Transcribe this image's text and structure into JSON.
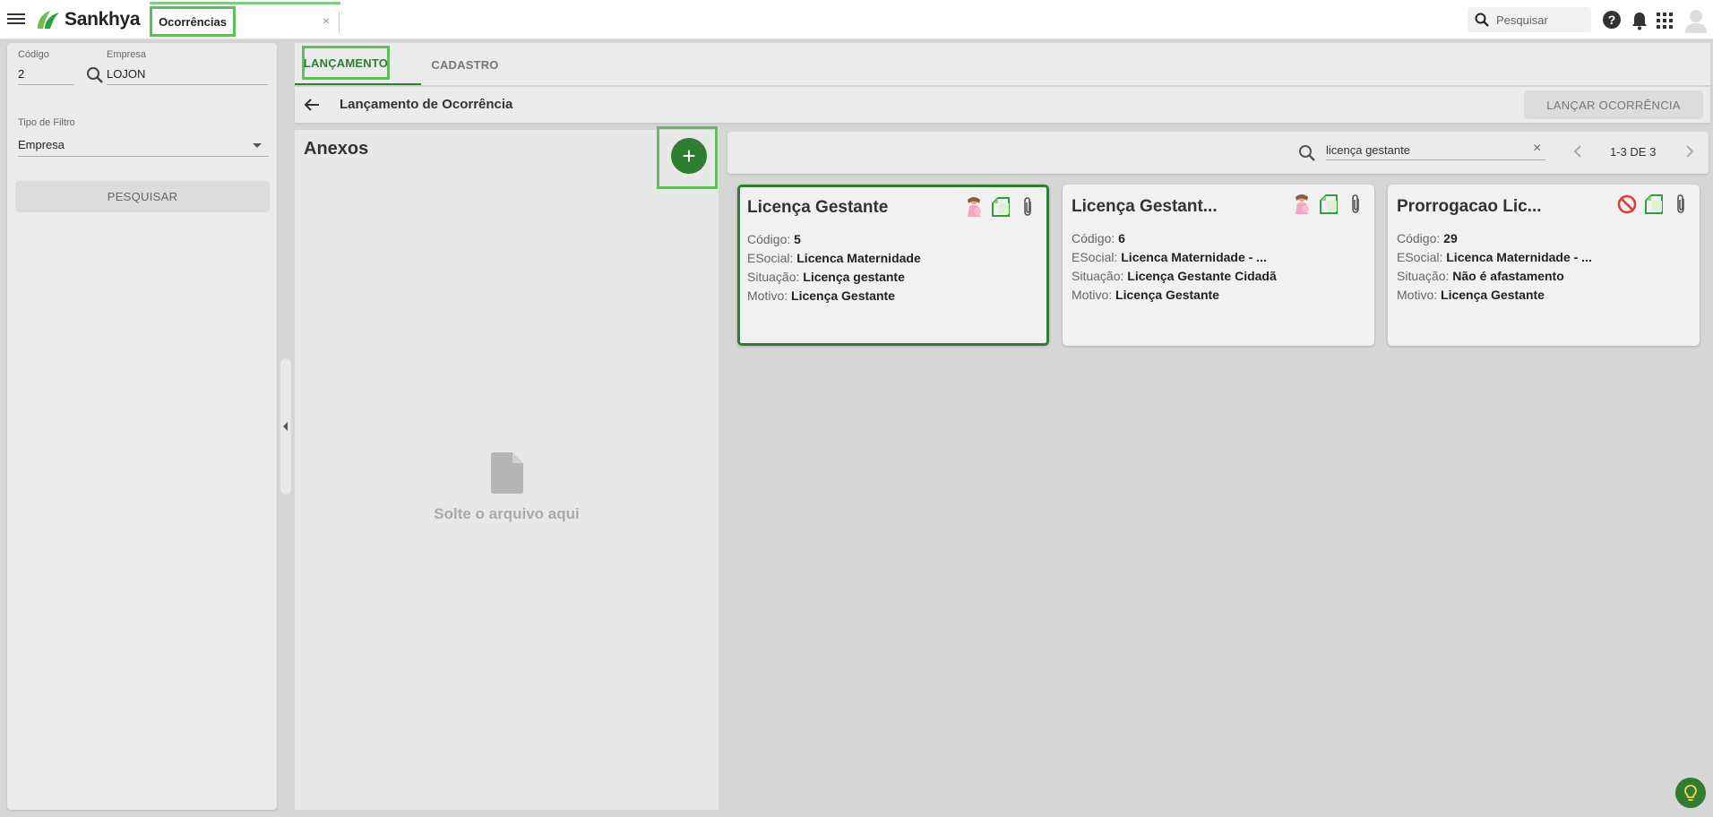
{
  "topbar": {
    "brand": "Sankhya",
    "app_tab_label": "Ocorrências",
    "app_tab_close": "×",
    "search_placeholder": "Pesquisar",
    "help_glyph": "?"
  },
  "filter": {
    "codigo_label": "Código",
    "codigo_value": "2",
    "empresa_label": "Empresa",
    "empresa_value": "LOJON",
    "tipo_filtro_label": "Tipo de Filtro",
    "tipo_filtro_value": "Empresa",
    "pesquisar_button": "PESQUISAR"
  },
  "tabs": [
    {
      "label": "LANÇAMENTO",
      "active": true
    },
    {
      "label": "CADASTRO",
      "active": false
    }
  ],
  "header": {
    "title": "Lançamento de Ocorrência",
    "action_button": "LANÇAR OCORRÊNCIA"
  },
  "anexos": {
    "title": "Anexos",
    "add_glyph": "+",
    "drop_text": "Solte o arquivo aqui"
  },
  "search": {
    "value": "licença gestante",
    "clear_glyph": "×",
    "pager_label": "1-3 DE 3"
  },
  "field_labels": {
    "codigo": "Código:",
    "esocial": "ESocial:",
    "situacao": "Situação:",
    "motivo": "Motivo:"
  },
  "cards": [
    {
      "title": "Licença Gestante",
      "codigo": "5",
      "esocial": "Licenca Maternidade",
      "situacao": "Licença gestante",
      "motivo": "Licença Gestante",
      "status_icon": "pregnant-woman-icon",
      "selected": true
    },
    {
      "title": "Licença Gestant...",
      "codigo": "6",
      "esocial": "Licenca Maternidade - ...",
      "situacao": "Licença Gestante Cidadã",
      "motivo": "Licença Gestante",
      "status_icon": "pregnant-woman-icon",
      "selected": false
    },
    {
      "title": "Prorrogacao Lic...",
      "codigo": "29",
      "esocial": "Licenca Maternidade - ...",
      "situacao": "Não é afastamento",
      "motivo": "Licença Gestante",
      "status_icon": "block-icon",
      "selected": false
    }
  ],
  "colors": {
    "brand_green": "#2e7d32",
    "highlight_green": "#5fbf5f",
    "block_red": "#e53935"
  }
}
